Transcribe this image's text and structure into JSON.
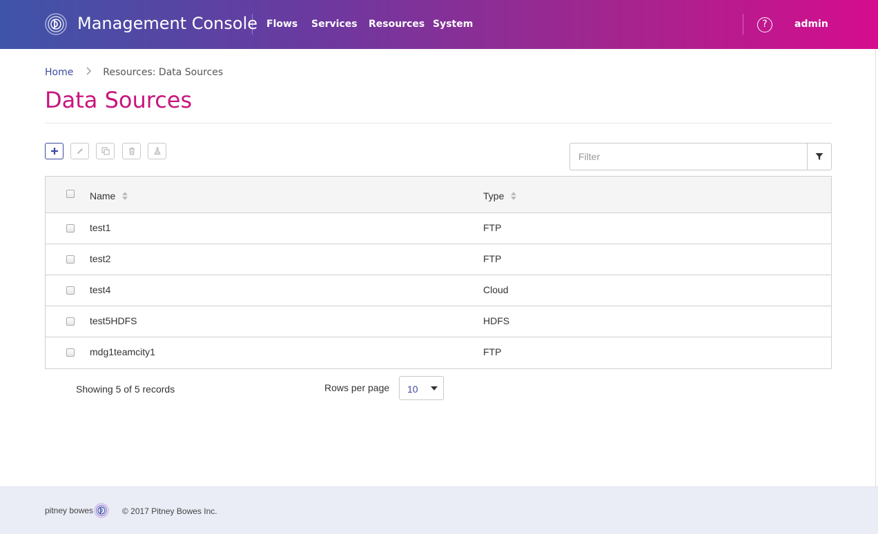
{
  "header": {
    "app_title": "Management Console",
    "nav": [
      "Flows",
      "Services",
      "Resources",
      "System"
    ],
    "help_glyph": "?",
    "user": "admin",
    "gradient": [
      "#3e54a8",
      "#d50c8e"
    ]
  },
  "breadcrumb": {
    "home": "Home",
    "current": "Resources: Data Sources"
  },
  "page": {
    "title": "Data Sources",
    "title_color": "#c8157d"
  },
  "toolbar": {
    "icons": [
      "add-icon",
      "edit-icon",
      "copy-icon",
      "delete-icon",
      "test-icon"
    ]
  },
  "filter": {
    "placeholder": "Filter"
  },
  "table": {
    "columns": [
      "Name",
      "Type"
    ],
    "rows": [
      {
        "name": "test1",
        "type": "FTP"
      },
      {
        "name": "test2",
        "type": "FTP"
      },
      {
        "name": "test4",
        "type": "Cloud"
      },
      {
        "name": "test5HDFS",
        "type": "HDFS"
      },
      {
        "name": "mdg1teamcity1",
        "type": "FTP"
      }
    ]
  },
  "pagination": {
    "records": "Showing 5 of 5 records",
    "rows_per_page_label": "Rows per page",
    "rows_per_page_value": "10"
  },
  "footer": {
    "brand": "pitney bowes",
    "copyright": "© 2017 Pitney Bowes Inc."
  }
}
